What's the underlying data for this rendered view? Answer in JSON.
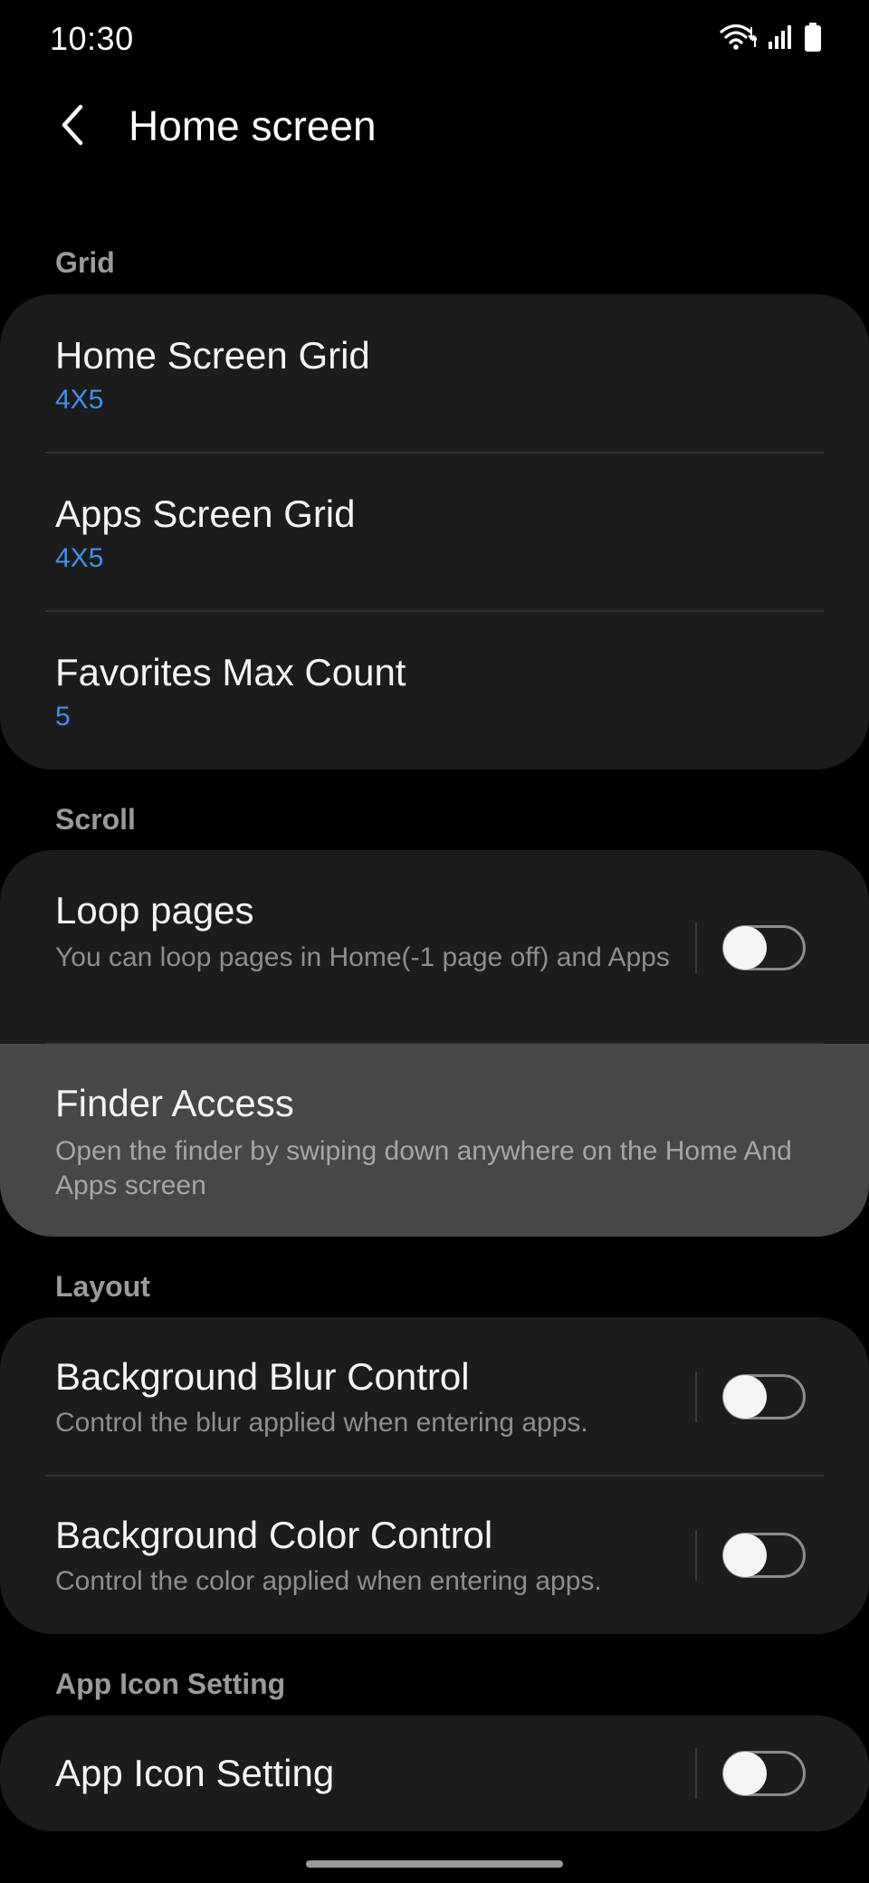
{
  "status_bar": {
    "time": "10:30",
    "icons": [
      "wifi-icon",
      "signal-icon",
      "battery-icon"
    ]
  },
  "header": {
    "title": "Home screen",
    "back_icon": "chevron-left-icon"
  },
  "sections": {
    "grid": {
      "header": "Grid",
      "items": [
        {
          "title": "Home Screen Grid",
          "value": "4X5"
        },
        {
          "title": "Apps Screen Grid",
          "value": "4X5"
        },
        {
          "title": "Favorites Max Count",
          "value": "5"
        }
      ]
    },
    "scroll": {
      "header": "Scroll",
      "items": [
        {
          "title": "Loop pages",
          "summary": "You can loop pages in Home(-1 page off) and Apps",
          "toggle_on": false
        },
        {
          "title": "Finder Access",
          "summary": "Open the finder by swiping down anywhere on the Home And Apps screen"
        }
      ]
    },
    "layout": {
      "header": "Layout",
      "items": [
        {
          "title": "Background Blur Control",
          "summary": "Control the blur applied when entering apps.",
          "toggle_on": false
        },
        {
          "title": "Background Color Control",
          "summary": "Control the color applied when entering apps.",
          "toggle_on": false
        }
      ]
    },
    "app_icon": {
      "header": "App Icon Setting",
      "items": [
        {
          "title": "App Icon Setting",
          "toggle_on": false
        }
      ]
    }
  },
  "colors": {
    "background": "#000000",
    "card": "#1c1c1c",
    "pressed_row": "#474747",
    "accent_value": "#3e91f0",
    "section_header": "#9a9a9a",
    "summary_text": "#8e8e8e"
  }
}
